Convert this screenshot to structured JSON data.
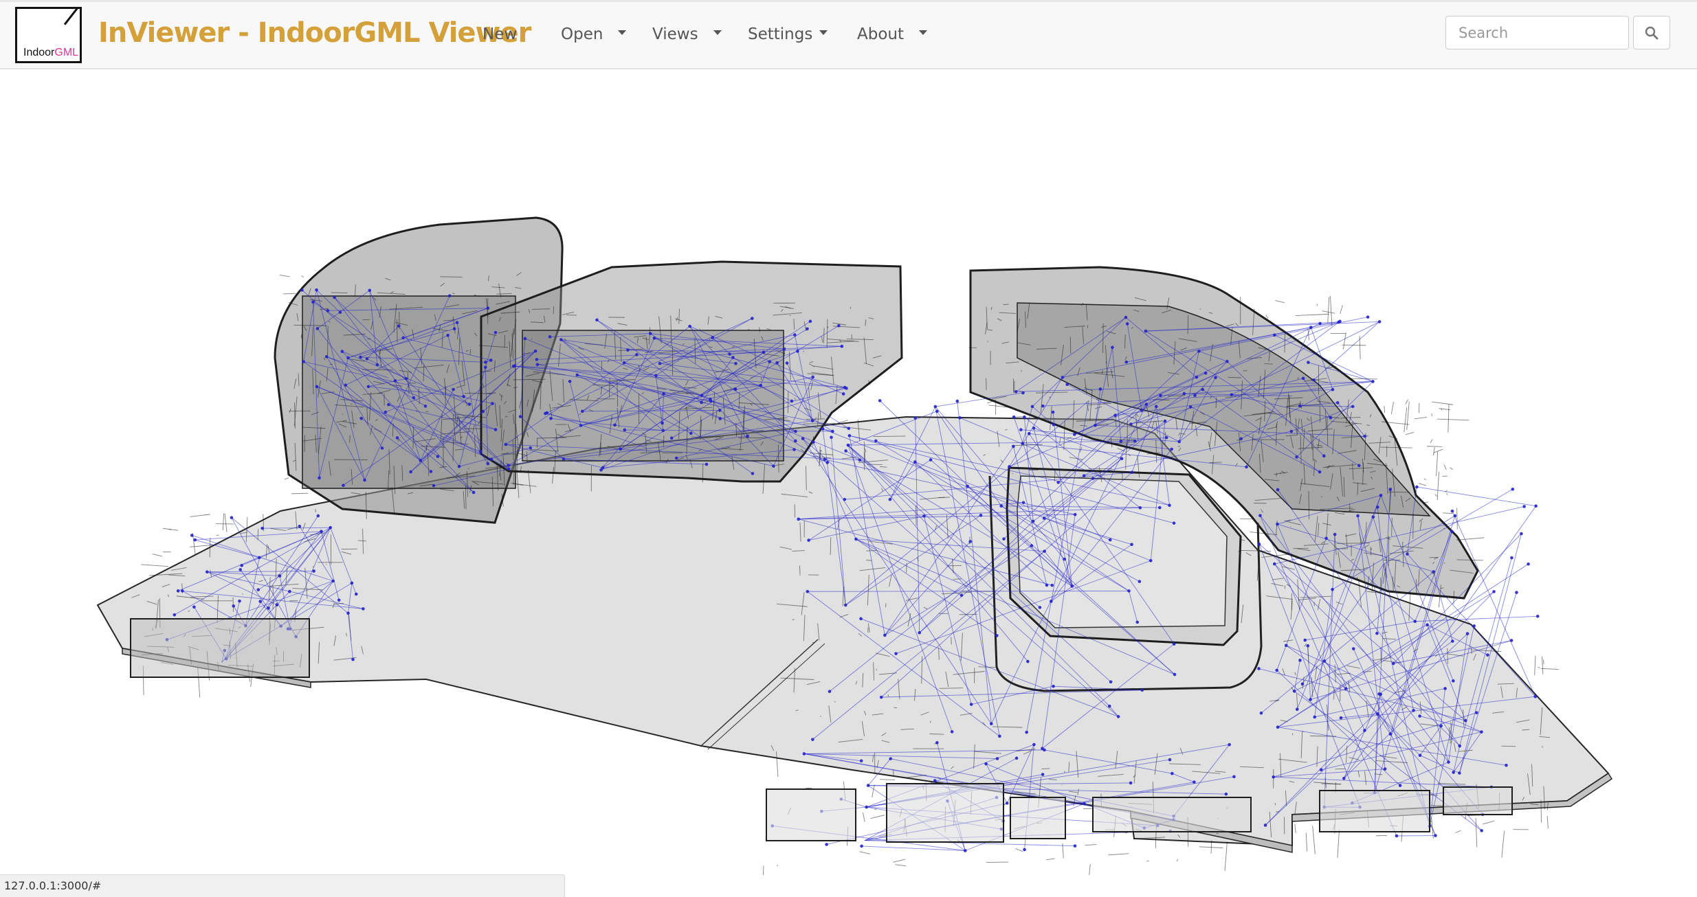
{
  "logo": {
    "text_plain": "Indoor",
    "text_accent": "GML"
  },
  "brand": {
    "title": "InViewer - IndoorGML Viewer"
  },
  "nav": {
    "new_label": "New",
    "open_label": "Open",
    "views_label": "Views",
    "settings_label": "Settings",
    "about_label": "About"
  },
  "search": {
    "placeholder": "Search",
    "value": "",
    "button_icon": "search-icon"
  },
  "viewport": {
    "content": "3D indoor building model",
    "colors": {
      "edges": "#1a1a1a",
      "network": "#2222cc",
      "floor": "#dddddd"
    }
  },
  "status": {
    "url": "127.0.0.1:3000/#"
  }
}
